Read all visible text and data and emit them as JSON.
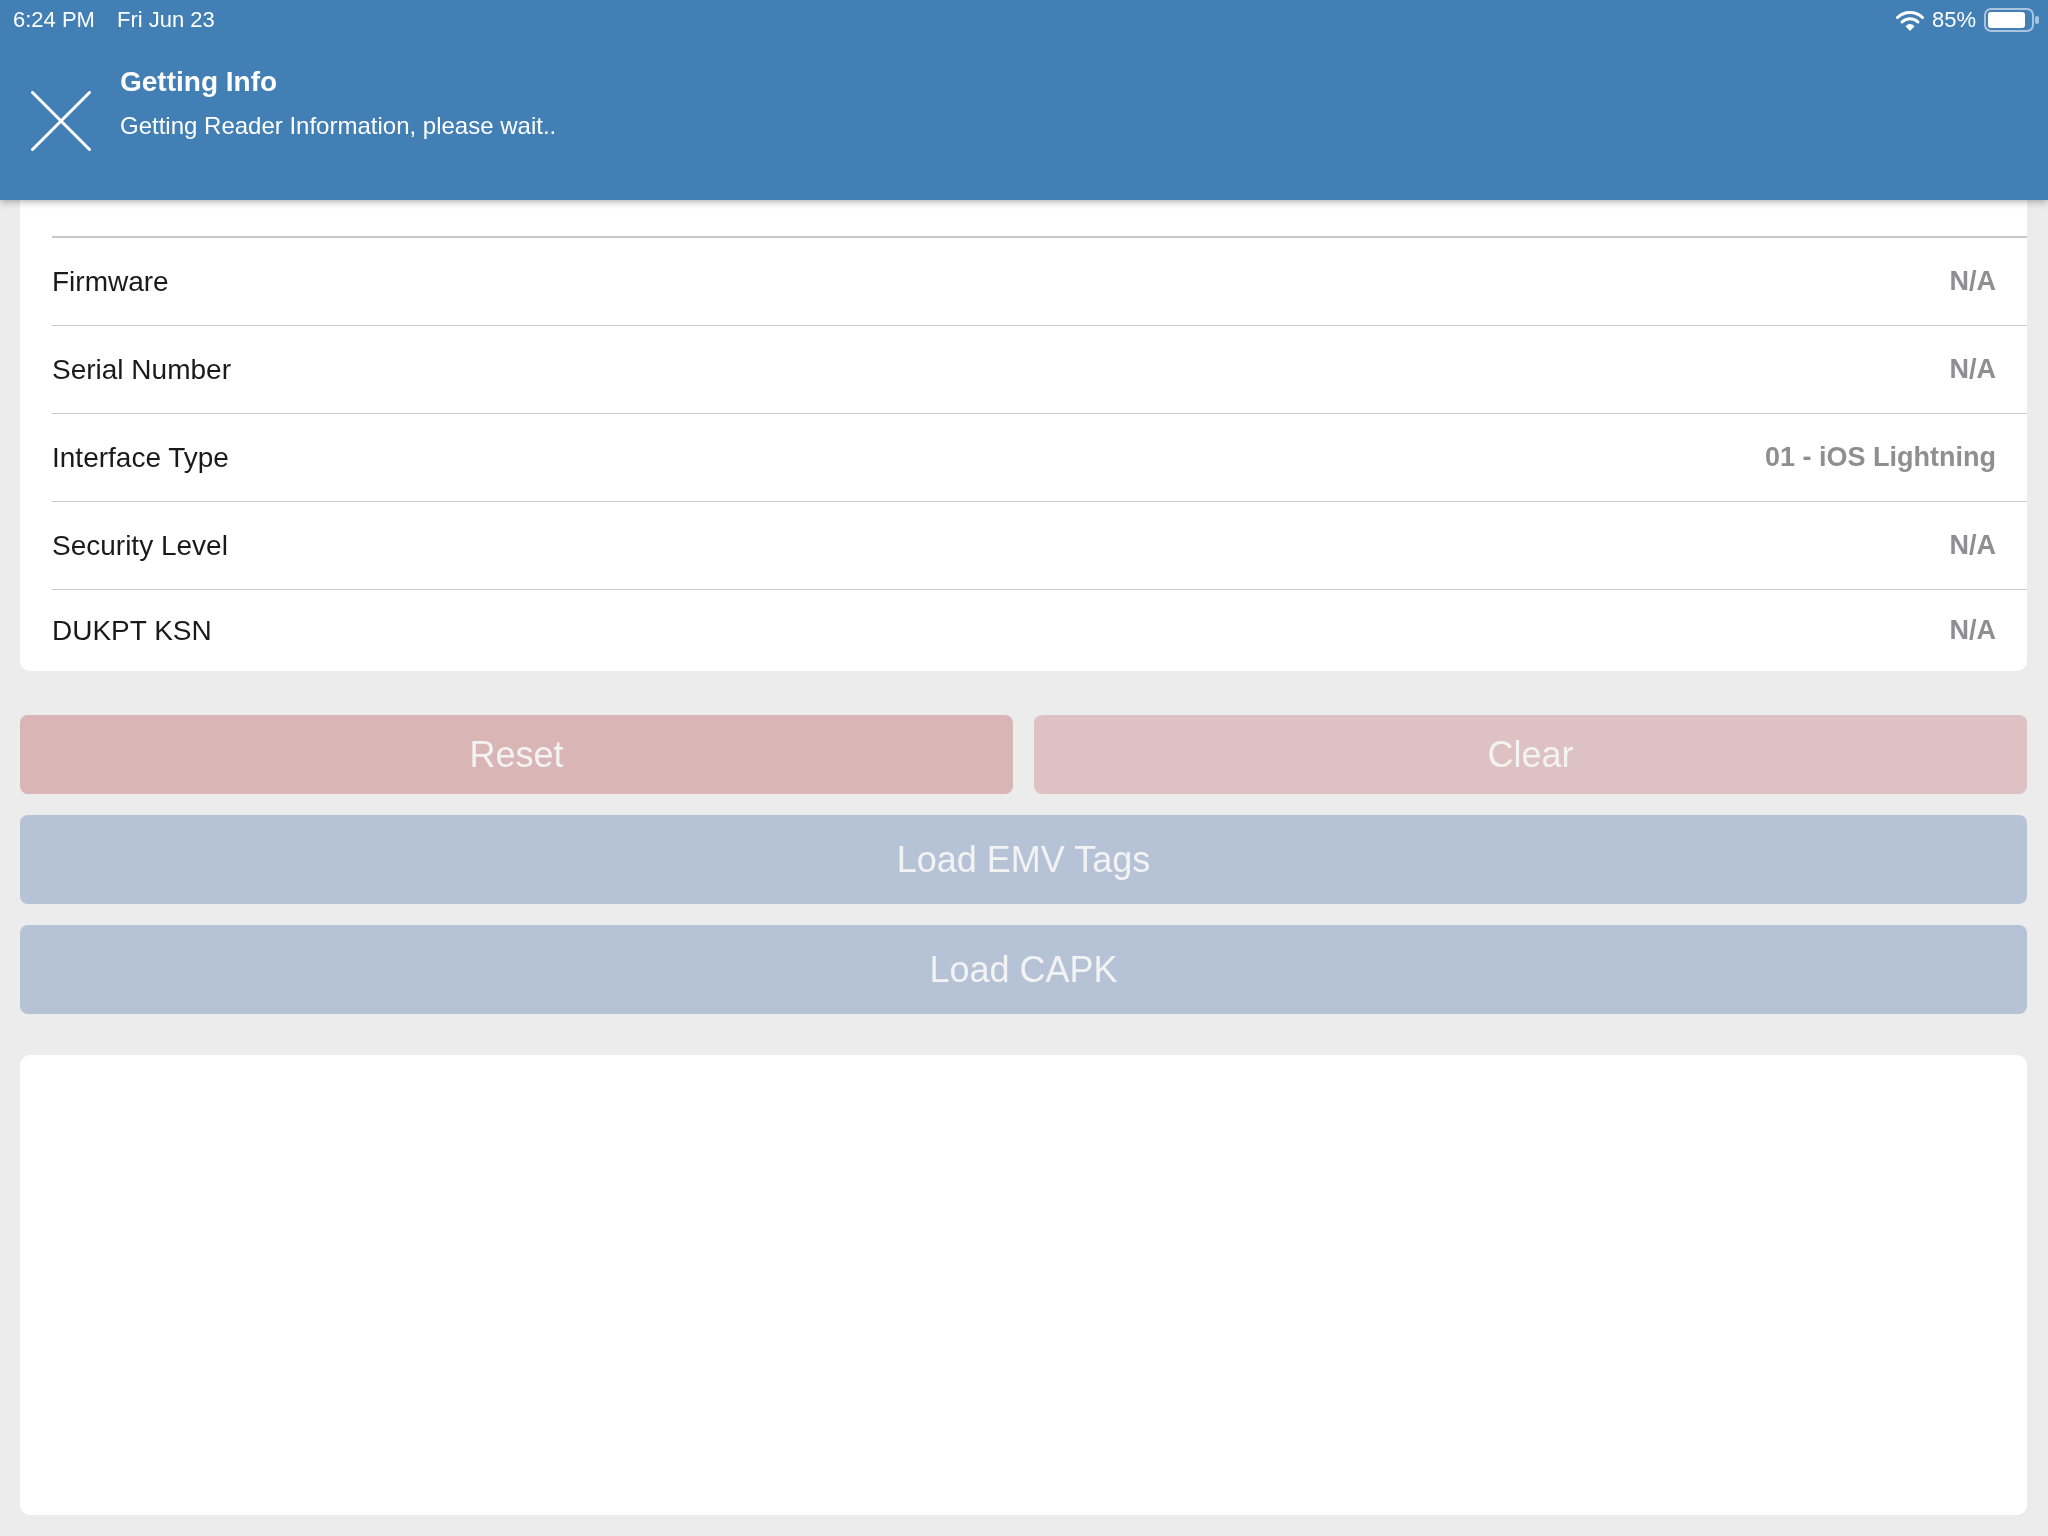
{
  "status_bar": {
    "time": "6:24 PM",
    "date": "Fri Jun 23",
    "battery": "85%"
  },
  "banner": {
    "title": "Getting Info",
    "message": "Getting Reader Information, please wait.."
  },
  "info_rows": [
    {
      "label": "Firmware",
      "value": "N/A"
    },
    {
      "label": "Serial Number",
      "value": "N/A"
    },
    {
      "label": "Interface Type",
      "value": "01 - iOS Lightning"
    },
    {
      "label": "Security Level",
      "value": "N/A"
    },
    {
      "label": "DUKPT KSN",
      "value": "N/A"
    }
  ],
  "button_rows": [
    [
      {
        "label": "Reset",
        "kind": "danger",
        "disabled": true
      },
      {
        "label": "Clear",
        "kind": "muted",
        "disabled": true
      }
    ],
    [
      {
        "label": "Load EMV Tags",
        "kind": "primary",
        "disabled": true
      }
    ],
    [
      {
        "label": "Load CAPK",
        "kind": "primary",
        "disabled": true
      }
    ]
  ]
}
